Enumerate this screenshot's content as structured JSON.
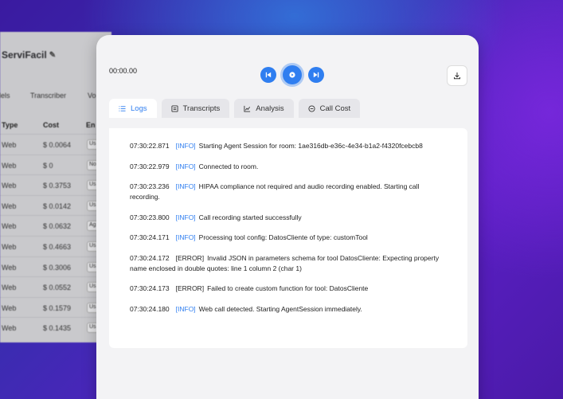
{
  "background_app": {
    "brand": "ServiFacil",
    "tabs": [
      "dels",
      "Transcriber",
      "Vo"
    ],
    "headers": [
      "Type",
      "Cost",
      "En"
    ],
    "rows": [
      {
        "type": "Web",
        "cost": "$ 0.0064",
        "tag": "Us"
      },
      {
        "type": "Web",
        "cost": "$ 0",
        "tag": "No"
      },
      {
        "type": "Web",
        "cost": "$ 0.3753",
        "tag": "Us"
      },
      {
        "type": "Web",
        "cost": "$ 0.0142",
        "tag": "Us"
      },
      {
        "type": "Web",
        "cost": "$ 0.0632",
        "tag": "Ag"
      },
      {
        "type": "Web",
        "cost": "$ 0.4663",
        "tag": "Us"
      },
      {
        "type": "Web",
        "cost": "$ 0.3006",
        "tag": "Us"
      },
      {
        "type": "Web",
        "cost": "$ 0.0552",
        "tag": "Us"
      },
      {
        "type": "Web",
        "cost": "$ 0.1579",
        "tag": "Us"
      },
      {
        "type": "Web",
        "cost": "$ 0.1435",
        "tag": "Us"
      }
    ]
  },
  "player": {
    "time": "00:00.00"
  },
  "tabs": [
    {
      "label": "Logs",
      "icon": "list-icon",
      "active": true
    },
    {
      "label": "Transcripts",
      "icon": "document-icon",
      "active": false
    },
    {
      "label": "Analysis",
      "icon": "chart-icon",
      "active": false
    },
    {
      "label": "Call Cost",
      "icon": "coin-icon",
      "active": false
    }
  ],
  "logs": [
    {
      "time": "07:30:22.871",
      "level": "[INFO]",
      "msg": "Starting Agent Session for room: 1ae316db-e36c-4e34-b1a2-f4320fcebcb8"
    },
    {
      "time": "07:30:22.979",
      "level": "[INFO]",
      "msg": "Connected to room."
    },
    {
      "time": "07:30:23.236",
      "level": "[INFO]",
      "msg": "HIPAA compliance not required and audio recording enabled. Starting call recording."
    },
    {
      "time": "07:30:23.800",
      "level": "[INFO]",
      "msg": "Call recording started successfully"
    },
    {
      "time": "07:30:24.171",
      "level": "[INFO]",
      "msg": "Processing tool config: DatosCliente of type: customTool"
    },
    {
      "time": "07:30:24.172",
      "level": "[ERROR]",
      "msg": "Invalid JSON in parameters schema for tool DatosCliente: Expecting property name enclosed in double quotes: line 1 column 2 (char 1)"
    },
    {
      "time": "07:30:24.173",
      "level": "[ERROR]",
      "msg": "Failed to create custom function for tool: DatosCliente"
    },
    {
      "time": "07:30:24.180",
      "level": "[INFO]",
      "msg": "Web call detected. Starting AgentSession immediately."
    }
  ],
  "colors": {
    "accent": "#2f7ef0",
    "panel": "#f3f3f5"
  }
}
